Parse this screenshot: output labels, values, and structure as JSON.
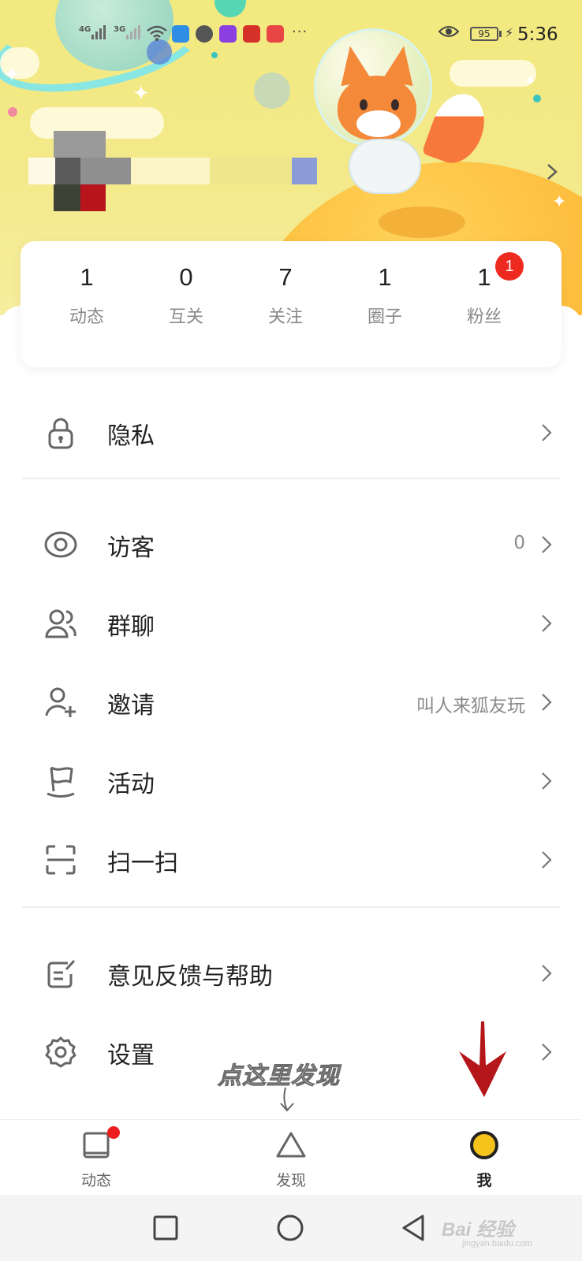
{
  "status_bar": {
    "network_1": "4G",
    "network_2": "3G",
    "more": "···",
    "battery": "95",
    "time": "5:36",
    "icons": [
      "signal-icon",
      "wifi-icon",
      "hotspot-icon",
      "chat-icon",
      "message-icon",
      "app-icon",
      "huawei-icon",
      "eye-icon",
      "battery-icon",
      "charging-icon"
    ]
  },
  "stats": [
    {
      "value": "1",
      "label": "动态"
    },
    {
      "value": "0",
      "label": "互关"
    },
    {
      "value": "7",
      "label": "关注"
    },
    {
      "value": "1",
      "label": "圈子"
    },
    {
      "value": "1",
      "label": "粉丝",
      "badge": "1"
    }
  ],
  "menu": [
    {
      "label": "隐私",
      "value": "",
      "icon": "lock-icon"
    },
    {
      "label": "访客",
      "value": "0",
      "icon": "eye-icon"
    },
    {
      "label": "群聊",
      "value": "",
      "icon": "group-icon"
    },
    {
      "label": "邀请",
      "value": "叫人来狐友玩",
      "icon": "add-user-icon"
    },
    {
      "label": "活动",
      "value": "",
      "icon": "flag-icon"
    },
    {
      "label": "扫一扫",
      "value": "",
      "icon": "scan-icon"
    },
    {
      "label": "意见反馈与帮助",
      "value": "",
      "icon": "feedback-icon"
    },
    {
      "label": "设置",
      "value": "",
      "icon": "gear-icon"
    }
  ],
  "annotation": {
    "hint": "点这里发现"
  },
  "tabs": [
    {
      "label": "动态",
      "icon": "square-icon",
      "dot": true
    },
    {
      "label": "发现",
      "icon": "triangle-icon"
    },
    {
      "label": "我",
      "icon": "circle-icon",
      "active": true
    }
  ],
  "watermark": {
    "text": "Bai  经验",
    "sub": "jingyan.baidu.com"
  },
  "colors": {
    "banner": "#f3e98a",
    "badge": "#ee2a1f",
    "accent_yellow": "#f6c21c",
    "arrow_red": "#b5161a"
  }
}
